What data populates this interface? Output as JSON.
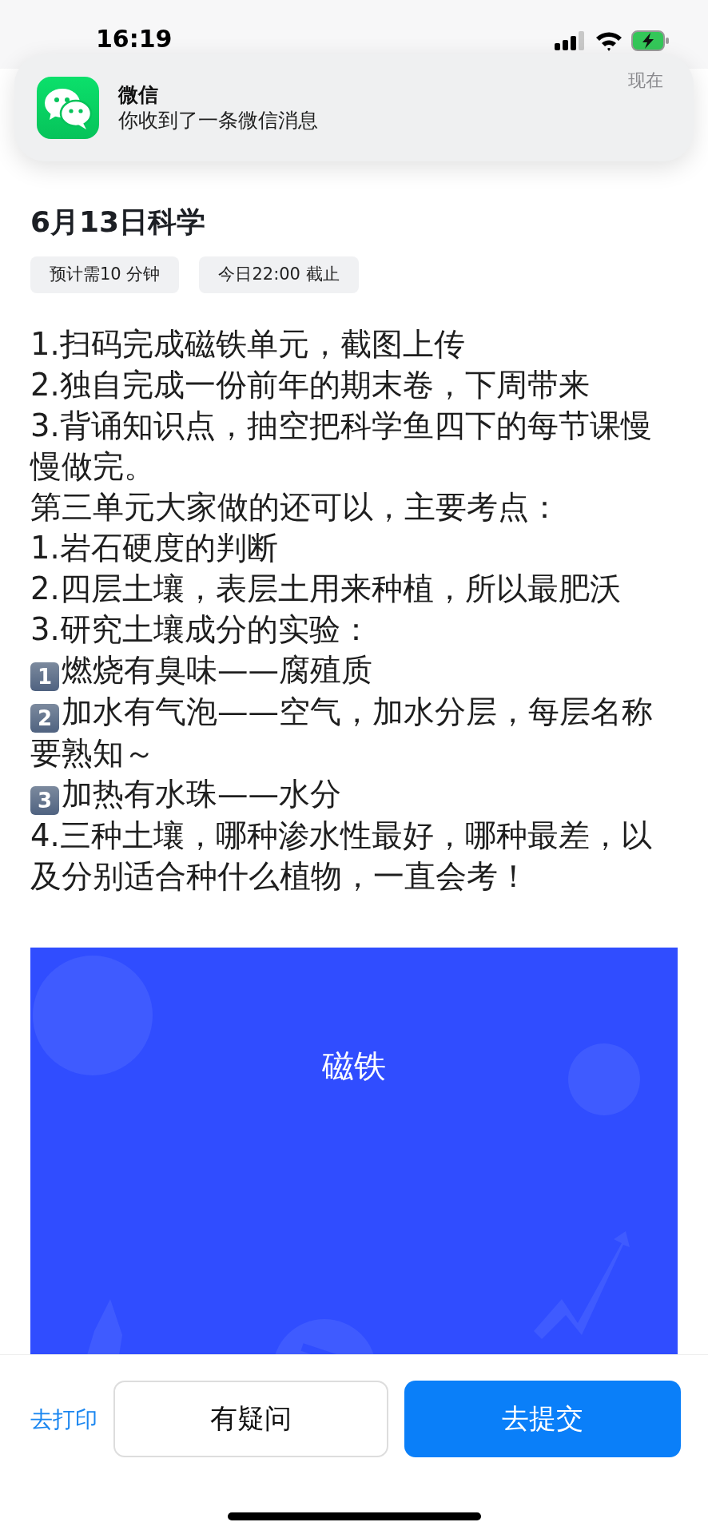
{
  "status_bar": {
    "time": "16:19"
  },
  "notification": {
    "app": "微信",
    "message": "你收到了一条微信消息",
    "time": "现在"
  },
  "assignment": {
    "title": "6月13日科学",
    "tags": [
      "预计需10 分钟",
      "今日22:00 截止"
    ],
    "lines": [
      {
        "kind": "text",
        "text": "1.扫码完成磁铁单元，截图上传"
      },
      {
        "kind": "text",
        "text": "2.独自完成一份前年的期末卷，下周带来"
      },
      {
        "kind": "text",
        "text": "3.背诵知识点，抽空把科学鱼四下的每节课慢慢做完。"
      },
      {
        "kind": "text",
        "text": "第三单元大家做的还可以，主要考点："
      },
      {
        "kind": "text",
        "text": "1.岩石硬度的判断"
      },
      {
        "kind": "text",
        "text": "2.四层土壤，表层土用来种植，所以最肥沃"
      },
      {
        "kind": "text",
        "text": "3.研究土壤成分的实验："
      },
      {
        "kind": "keycap",
        "number": "1",
        "text": "燃烧有臭味——腐殖质"
      },
      {
        "kind": "keycap",
        "number": "2",
        "text": "加水有气泡——空气，加水分层，每层名称"
      },
      {
        "kind": "text",
        "text": "要熟知～"
      },
      {
        "kind": "keycap",
        "number": "3",
        "text": "加热有水珠——水分"
      },
      {
        "kind": "text",
        "text": "4.三种土壤，哪种渗水性最好，哪种最差，以及分别适合种什么植物，一直会考！"
      }
    ],
    "banner": {
      "title": "磁铁"
    }
  },
  "actions": {
    "print_link": "去打印",
    "ask_button": "有疑问",
    "submit_button": "去提交"
  }
}
